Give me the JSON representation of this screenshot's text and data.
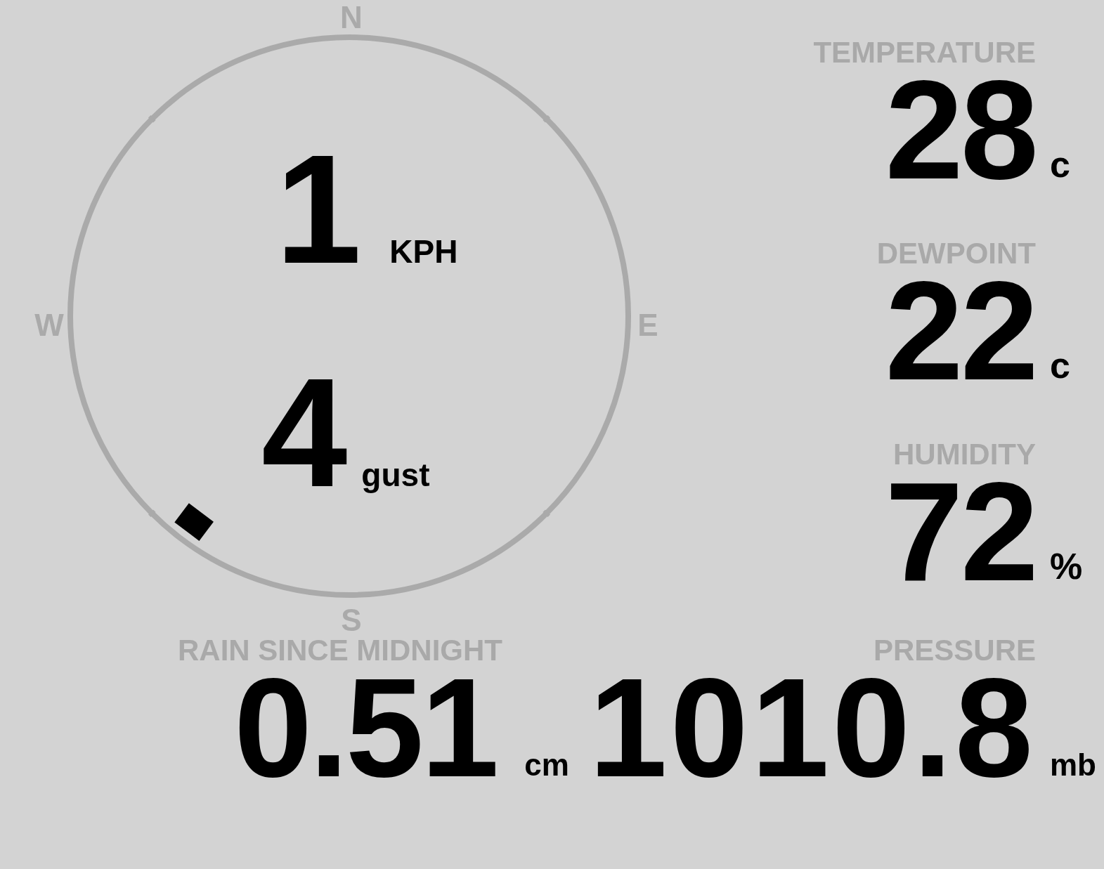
{
  "compass": {
    "labels": [
      "N",
      "E",
      "S",
      "W"
    ]
  },
  "wind": [
    {
      "value": "1",
      "unit": "KPH"
    },
    {
      "value": "4",
      "unit": "gust"
    }
  ],
  "readings": [
    {
      "label": "TEMPERATURE",
      "value": "28",
      "unit": "c"
    },
    {
      "label": "DEWPOINT",
      "value": "22",
      "unit": "c"
    },
    {
      "label": "HUMIDITY",
      "value": "72",
      "unit": "%"
    }
  ],
  "rain": {
    "label": "RAIN SINCE MIDNIGHT",
    "value": "0.51",
    "unit": "cm"
  },
  "pressure": {
    "label": "PRESSURE",
    "value": "1010.8",
    "unit": "mb"
  }
}
